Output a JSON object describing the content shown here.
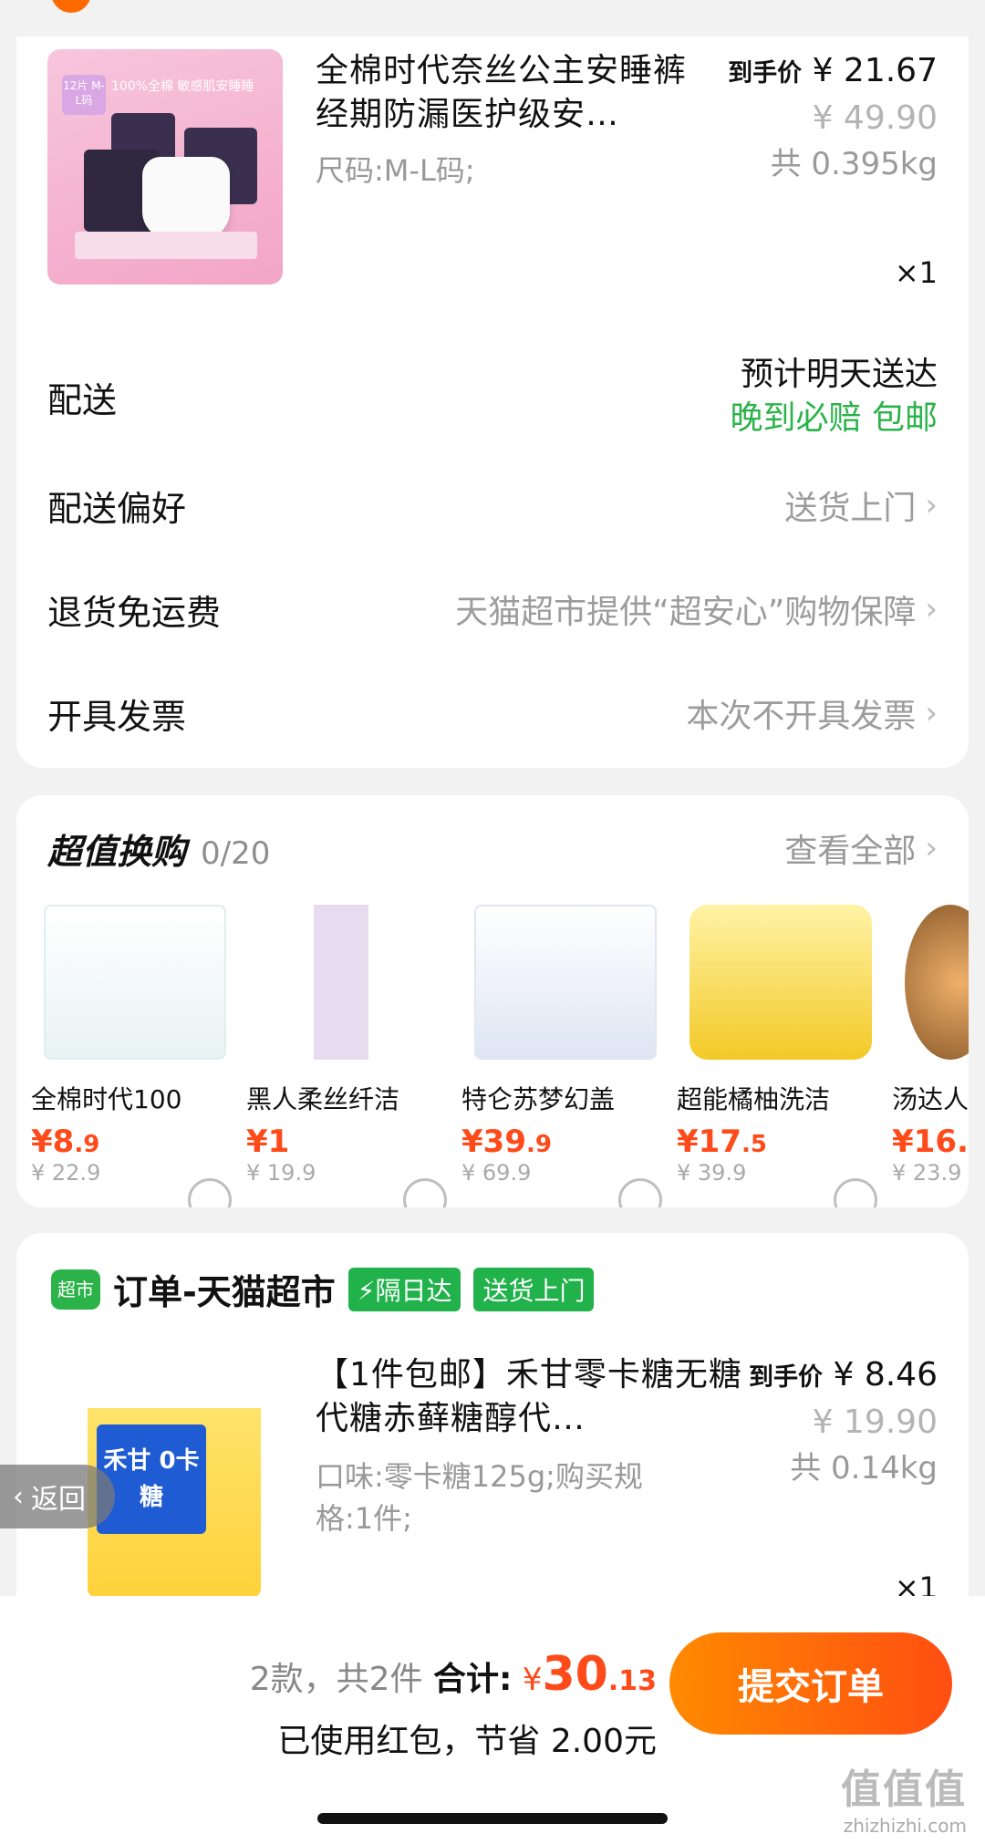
{
  "product1": {
    "title": "全棉时代奈丝公主安睡裤经期防漏医护级安…",
    "spec": "尺码:M-L码;",
    "price_label": "到手价",
    "price": "¥ 21.67",
    "original_price": "¥ 49.90",
    "weight": "共 0.395kg",
    "qty": "×1",
    "img_badge": "12片 M-L码",
    "img_caption": "100%全棉 敏感肌安睡睡"
  },
  "rows": {
    "delivery_label": "配送",
    "delivery_line1": "预计明天送达",
    "delivery_line2": "晚到必赔 包邮",
    "pref_label": "配送偏好",
    "pref_value": "送货上门",
    "return_label": "退货免运费",
    "return_value": "天猫超市提供“超安心”购物保障",
    "invoice_label": "开具发票",
    "invoice_value": "本次不开具发票"
  },
  "swap": {
    "title": "超值换购",
    "count": "0/20",
    "view_all": "查看全部",
    "items": [
      {
        "name": "全棉时代100",
        "price_int": "¥8",
        "price_dec": ".9",
        "orig": "¥ 22.9"
      },
      {
        "name": "黑人柔丝纤洁",
        "price_int": "¥1",
        "price_dec": "",
        "orig": "¥ 19.9"
      },
      {
        "name": "特仑苏梦幻盖",
        "price_int": "¥39",
        "price_dec": ".9",
        "orig": "¥ 69.9"
      },
      {
        "name": "超能橘柚洗洁",
        "price_int": "¥17",
        "price_dec": ".5",
        "orig": "¥ 39.9"
      },
      {
        "name": "汤达人",
        "price_int": "¥16.",
        "price_dec": "",
        "orig": "¥ 23.9"
      }
    ]
  },
  "order": {
    "shop_icon": "超市",
    "shop_name": "订单-天猫超市",
    "tag1": "⚡隔日达",
    "tag2": "送货上门"
  },
  "product2": {
    "title": "【1件包邮】禾甘零卡糖无糖代糖赤藓糖醇代…",
    "spec": "口味:零卡糖125g;购买规格:1件;",
    "price_label": "到手价",
    "price": "¥ 8.46",
    "original_price": "¥ 19.90",
    "weight": "共 0.14kg",
    "qty": "×1",
    "img_text": "禾甘 0卡糖"
  },
  "back": {
    "label": "返回"
  },
  "bottom": {
    "count": "2款，共2件",
    "total_label": "合计:",
    "yen": "¥",
    "total_int": "30",
    "total_dec": ".13",
    "savings": "已使用红包，节省 2.00元",
    "submit": "提交订单"
  },
  "watermark": {
    "line1": "值值值",
    "line2": "zhizhizhi.com"
  },
  "colors": {
    "accent": "#ff4a1a",
    "green": "#2bb34a",
    "button": "#ff6a00"
  }
}
